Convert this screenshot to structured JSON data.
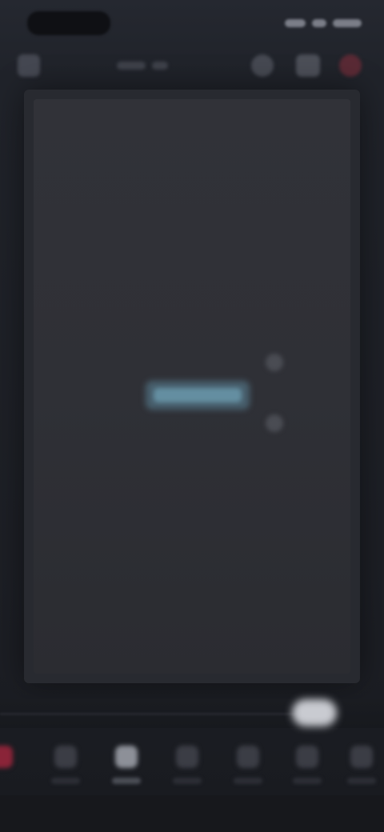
{
  "app": {
    "accent_color": "#8a2438",
    "canvas_color": "#2f3036",
    "selection_color": "#78b9d7"
  },
  "status_bar": {
    "time_text": "",
    "indicators": [
      "signal-icon",
      "wifi-icon",
      "battery-icon"
    ]
  },
  "top_toolbar": {
    "back_icon": "back-arrow-icon",
    "title_text": "",
    "actions": [
      {
        "name": "search-icon"
      },
      {
        "name": "layers-icon"
      },
      {
        "name": "record-icon"
      }
    ]
  },
  "canvas": {
    "text_element_text": "",
    "rotate_handle_icon": "rotate-icon",
    "resize_handle_icon": "resize-icon"
  },
  "timeline": {
    "playhead_fraction": 0.86
  },
  "bottom_toolbar": {
    "tools": [
      {
        "icon": "add-clip-icon",
        "label": ""
      },
      {
        "icon": "edit-icon",
        "label": ""
      },
      {
        "icon": "text-icon",
        "label": "",
        "active": true
      },
      {
        "icon": "audio-icon",
        "label": ""
      },
      {
        "icon": "effects-icon",
        "label": ""
      },
      {
        "icon": "filter-icon",
        "label": ""
      },
      {
        "icon": "more-icon",
        "label": ""
      }
    ]
  }
}
